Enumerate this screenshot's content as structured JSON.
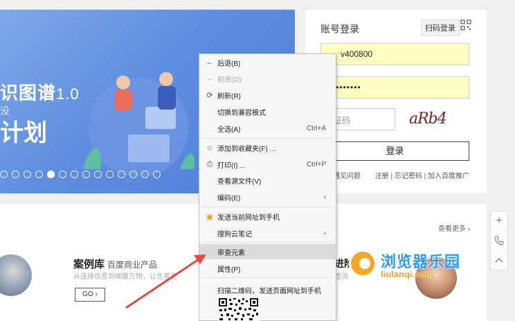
{
  "banner": {
    "title_left": "识图谱",
    "title_version": "1.0",
    "subtitle": "没",
    "title_line2": "计划",
    "dots_count": 14,
    "active_dot": 4
  },
  "login": {
    "title": "账号登录",
    "scan_label": "扫码登录",
    "username_value": "v400800",
    "password_value": "••••••••",
    "captcha_placeholder": "证码",
    "captcha_text": "aRb4",
    "submit_label": "登录",
    "link_left": "遇见问题",
    "link_right": "注册 | 忘记密码 | 加入百度推广"
  },
  "lower": {
    "more_label": "查看更多",
    "case_title": "案例库",
    "case_subtitle": "百度商业产品",
    "case_desc": "从连接信息到唤醒万物，让生意更",
    "go_label": "GO",
    "adv_title": "进阶",
    "adv_desc": "遗流"
  },
  "watermark": {
    "text": "浏览器乐园",
    "url": "liulanqi.com"
  },
  "context_menu": {
    "back": "后退(B)",
    "forward": "前进(O)",
    "refresh": "刷新(R)",
    "compat": "切换到兼容模式",
    "select_all": "全选(A)",
    "select_all_shortcut": "Ctrl+A",
    "favorite": "添加到收藏夹(F) ...",
    "print": "打印(I) ...",
    "print_shortcut": "Ctrl+P",
    "view_source": "查看源文件(V)",
    "encoding": "编码(E)",
    "send_to_phone": "发送当前网址到手机",
    "sogou_notes": "搜狗云笔记",
    "inspect": "审查元素",
    "properties": "属性(P)",
    "scan_qr": "扫描二维码，发送页面网址到手机"
  },
  "colors": {
    "banner": "#5f8ee0",
    "autofill": "#ffffc4",
    "menu_highlight": "#dcdcdc",
    "arrow": "#e04a3a",
    "watermark_blue": "#2c9bf0",
    "watermark_orange": "#f6a623"
  },
  "icons": {
    "back": "arrow-left-icon",
    "forward": "arrow-right-icon",
    "refresh": "refresh-icon",
    "favorite": "star-icon",
    "print": "printer-icon",
    "send_to_phone": "phone-send-icon",
    "submenu": "chevron-right-icon"
  }
}
